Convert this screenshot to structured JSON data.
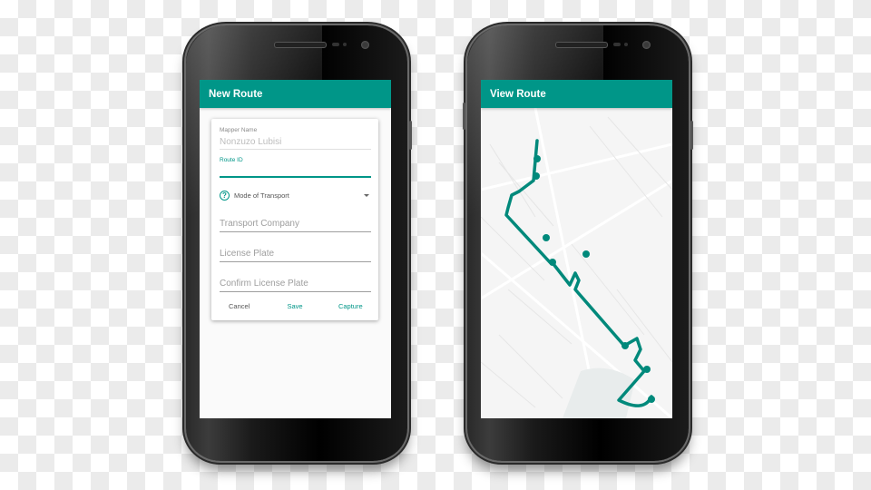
{
  "colors": {
    "accent": "#009688",
    "map_background": "#f5f5f5"
  },
  "left_phone": {
    "appbar_title": "New Route",
    "form": {
      "mapper_name_label": "Mapper Name",
      "mapper_name_value": "Nonzuzo Lubisi",
      "route_id_label": "Route ID",
      "route_id_value": "",
      "mode_of_transport": {
        "icon": "help-circle-icon",
        "label": "Mode of Transport"
      },
      "transport_company_placeholder": "Transport Company",
      "license_plate_placeholder": "License Plate",
      "confirm_license_plate_placeholder": "Confirm License Plate"
    },
    "actions": {
      "cancel": "Cancel",
      "save": "Save",
      "capture": "Capture"
    }
  },
  "right_phone": {
    "appbar_title": "View Route",
    "map": {
      "description": "Map with teal route polyline and waypoint markers"
    }
  }
}
